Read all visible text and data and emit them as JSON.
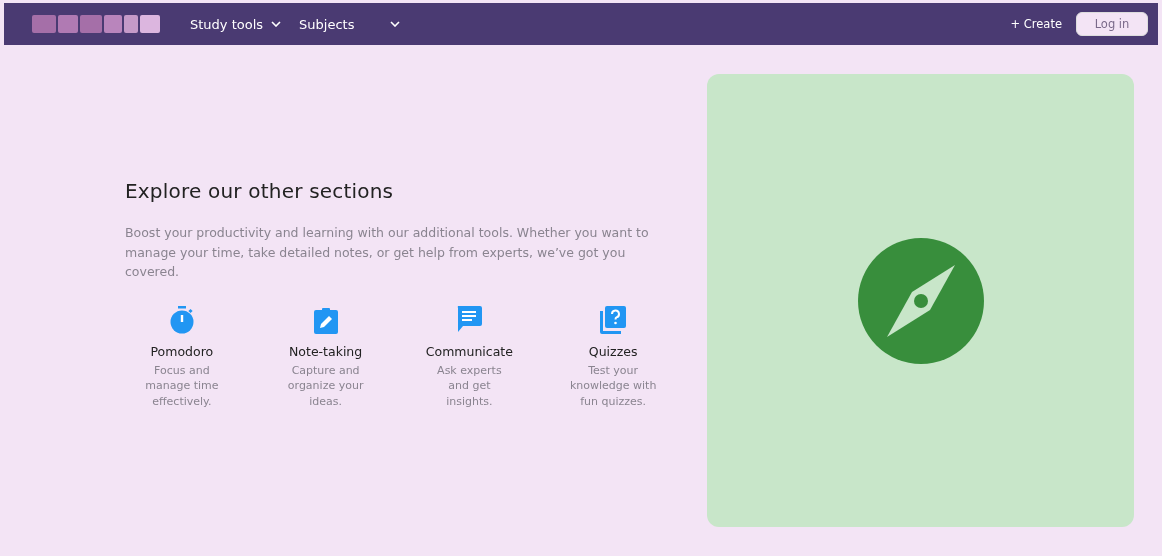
{
  "nav": {
    "menus": [
      {
        "label": "Study tools",
        "caret": true
      },
      {
        "label": "Subjects",
        "caret": true
      }
    ],
    "create": "+ Create",
    "login": "Log in"
  },
  "section": {
    "title": "Explore our other sections",
    "description": "Boost your productivity and learning with our additional tools. Whether you want to manage your time, take detailed notes, or get help from experts, we’ve got you covered.",
    "features": [
      {
        "kind": "timer",
        "title": "Pomodoro",
        "text": "Focus and\nmanage time\neffectively."
      },
      {
        "kind": "note",
        "title": "Note-taking",
        "text": "Capture and\norganize your\nideas."
      },
      {
        "kind": "chat",
        "title": "Communicate",
        "text": "Ask experts\nand get\ninsights."
      },
      {
        "kind": "quiz",
        "title": "Quizzes",
        "text": "Test your\nknowledge with\nfun quizzes."
      }
    ]
  }
}
